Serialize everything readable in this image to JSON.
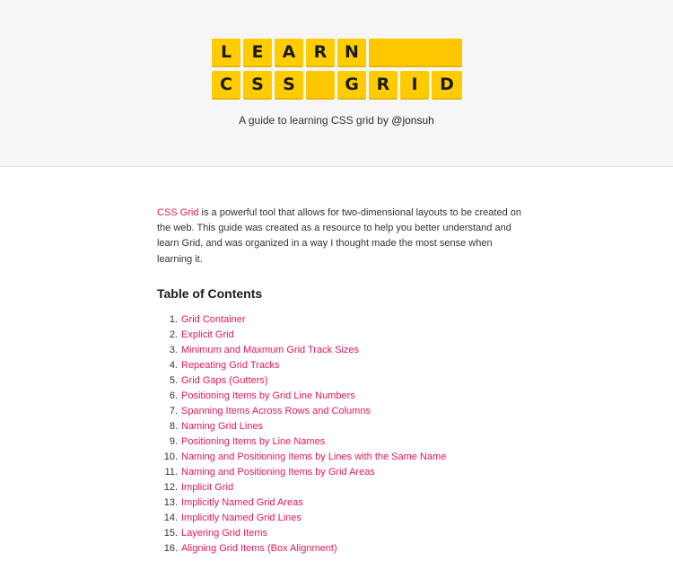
{
  "header": {
    "logo": {
      "row1": [
        "L",
        "E",
        "A",
        "R",
        "N"
      ],
      "row2": [
        "C",
        "S",
        "S",
        "",
        "G",
        "R",
        "I",
        "D"
      ]
    },
    "tagline_text": "A guide to learning CSS grid by ",
    "tagline_handle": "@jonsuh"
  },
  "intro": {
    "link_text": "CSS Grid",
    "text": " is a powerful tool that allows for two-dimensional layouts to be created on the web. This guide was created as a resource to help you better understand and learn Grid, and was organized in a way I thought made the most sense when learning it."
  },
  "toc": {
    "heading": "Table of Contents",
    "items": [
      {
        "num": "1.",
        "label": "Grid Container"
      },
      {
        "num": "2.",
        "label": "Explicit Grid"
      },
      {
        "num": "3.",
        "label": "Minimum and Maxmum Grid Track Sizes"
      },
      {
        "num": "4.",
        "label": "Repeating Grid Tracks"
      },
      {
        "num": "5.",
        "label": "Grid Gaps (Gutters)"
      },
      {
        "num": "6.",
        "label": "Positioning Items by Grid Line Numbers"
      },
      {
        "num": "7.",
        "label": "Spanning Items Across Rows and Columns"
      },
      {
        "num": "8.",
        "label": "Naming Grid Lines"
      },
      {
        "num": "9.",
        "label": "Positioning Items by Line Names"
      },
      {
        "num": "10.",
        "label": "Naming and Positioning Items by Lines with the Same Name"
      },
      {
        "num": "11.",
        "label": "Naming and Positioning Items by Grid Areas"
      },
      {
        "num": "12.",
        "label": "Implicit Grid"
      },
      {
        "num": "13.",
        "label": "Implicitly Named Grid Areas"
      },
      {
        "num": "14.",
        "label": "Implicitly Named Grid Lines"
      },
      {
        "num": "15.",
        "label": "Layering Grid Items"
      },
      {
        "num": "16.",
        "label": "Aligning Grid Items (Box Alignment)"
      }
    ]
  },
  "colors": {
    "tile": "#ffcc00",
    "link": "#e3185b",
    "header_bg": "#f6f6f8"
  }
}
